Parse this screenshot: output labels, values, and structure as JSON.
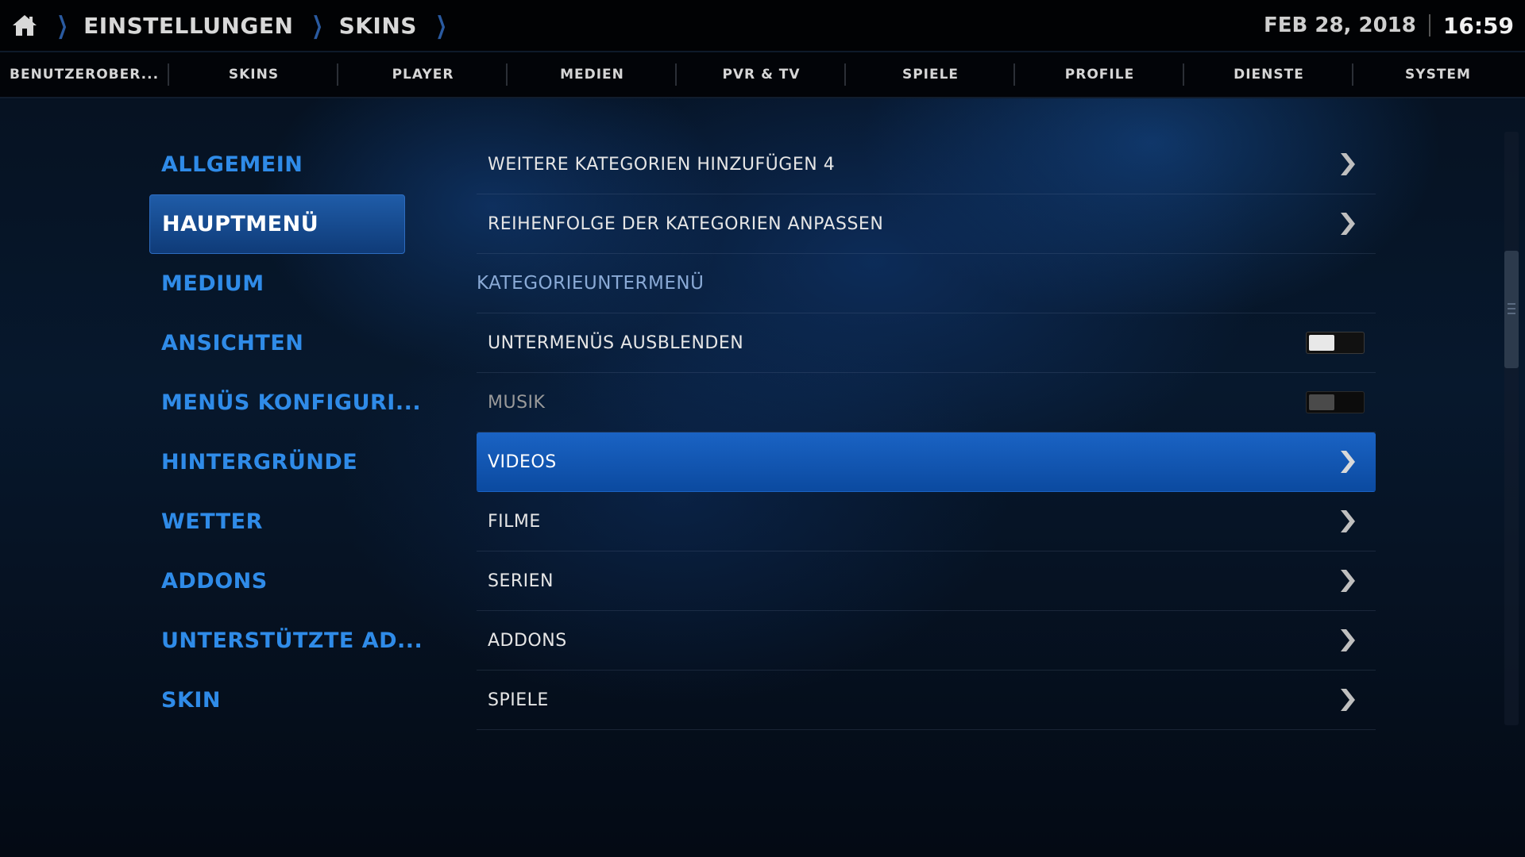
{
  "breadcrumb": {
    "home_icon": "home-icon",
    "items": [
      "EINSTELLUNGEN",
      "SKINS"
    ]
  },
  "clock": {
    "date": "FEB 28, 2018",
    "time": "16:59"
  },
  "tabs": [
    "BENUTZEROBER...",
    "SKINS",
    "PLAYER",
    "MEDIEN",
    "PVR & TV",
    "SPIELE",
    "PROFILE",
    "DIENSTE",
    "SYSTEM"
  ],
  "left_menu": {
    "active_index": 1,
    "items": [
      "ALLGEMEIN",
      "HAUPTMENÜ",
      "MEDIUM",
      "ANSICHTEN",
      "MENÜS KONFIGURI...",
      "HINTERGRÜNDE",
      "WETTER",
      "ADDONS",
      "UNTERSTÜTZTE AD...",
      "SKIN"
    ]
  },
  "settings": {
    "rows": [
      {
        "label": "WEITERE KATEGORIEN HINZUFÜGEN 4",
        "type": "submenu"
      },
      {
        "label": "REIHENFOLGE DER KATEGORIEN ANPASSEN",
        "type": "submenu"
      },
      {
        "label": "KATEGORIEUNTERMENÜ",
        "type": "header"
      },
      {
        "label": "UNTERMENÜS AUSBLENDEN",
        "type": "toggle",
        "enabled": true
      },
      {
        "label": "MUSIK",
        "type": "toggle",
        "enabled": false,
        "disabled": true
      },
      {
        "label": "VIDEOS",
        "type": "submenu",
        "selected": true
      },
      {
        "label": "FILME",
        "type": "submenu"
      },
      {
        "label": "SERIEN",
        "type": "submenu"
      },
      {
        "label": "ADDONS",
        "type": "submenu"
      },
      {
        "label": "SPIELE",
        "type": "submenu"
      }
    ]
  },
  "colors": {
    "accent": "#2f8be8",
    "selected_bg": "#1a63c4",
    "header_text": "#8aaad6"
  }
}
